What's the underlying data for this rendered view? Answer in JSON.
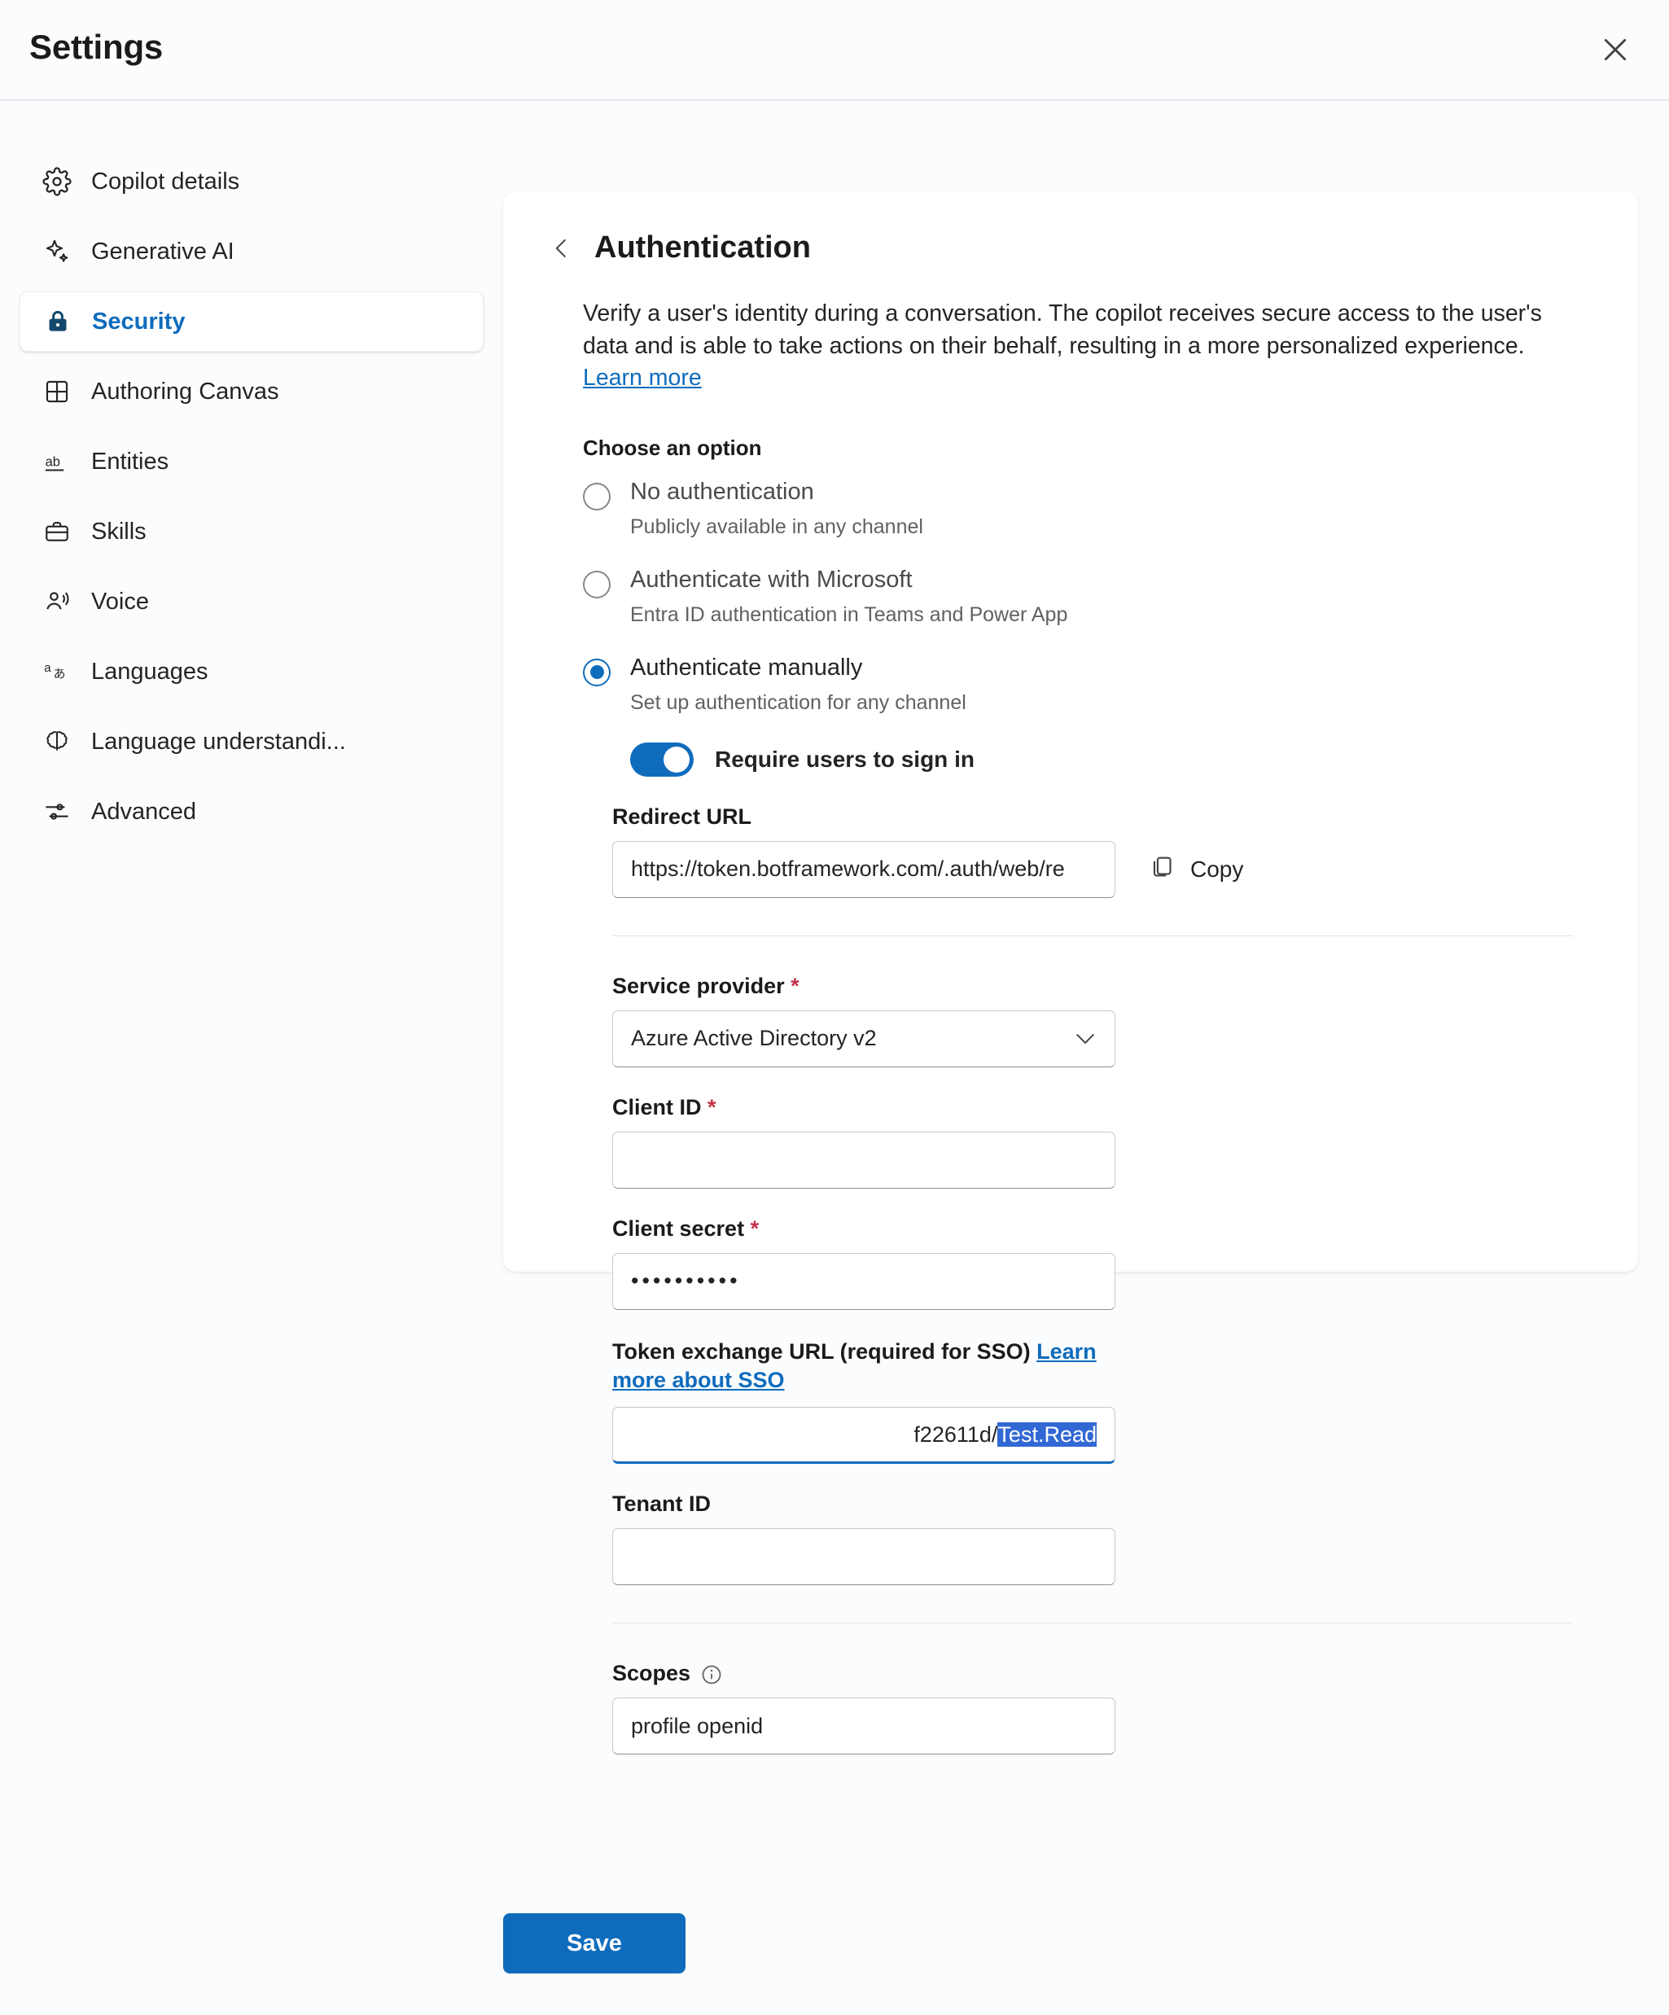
{
  "header": {
    "title": "Settings",
    "close_icon": "close-icon"
  },
  "sidebar": {
    "items": [
      {
        "label": "Copilot details",
        "icon": "gear-icon",
        "active": false
      },
      {
        "label": "Generative AI",
        "icon": "sparkle-icon",
        "active": false
      },
      {
        "label": "Security",
        "icon": "lock-icon",
        "active": true
      },
      {
        "label": "Authoring Canvas",
        "icon": "grid-icon",
        "active": false
      },
      {
        "label": "Entities",
        "icon": "ab-text-icon",
        "active": false
      },
      {
        "label": "Skills",
        "icon": "briefcase-icon",
        "active": false
      },
      {
        "label": "Voice",
        "icon": "person-speaking-icon",
        "active": false
      },
      {
        "label": "Languages",
        "icon": "translate-icon",
        "active": false
      },
      {
        "label": "Language understandi...",
        "icon": "brain-icon",
        "active": false
      },
      {
        "label": "Advanced",
        "icon": "sliders-icon",
        "active": false
      }
    ]
  },
  "panel": {
    "back_icon": "chevron-left-icon",
    "title": "Authentication",
    "description_part1": "Verify a user's identity during a conversation. The copilot receives secure access to the user's data and is able to take actions on their behalf, resulting in a more personalized experience. ",
    "description_link": "Learn more",
    "choose_label": "Choose an option",
    "options": [
      {
        "label": "No authentication",
        "sub": "Publicly available in any channel",
        "selected": false
      },
      {
        "label": "Authenticate with Microsoft",
        "sub": "Entra ID authentication in Teams and Power App",
        "selected": false
      },
      {
        "label": "Authenticate manually",
        "sub": "Set up authentication for any channel",
        "selected": true
      }
    ],
    "require_signin": {
      "label": "Require users to sign in",
      "on": true
    },
    "redirect_url": {
      "label": "Redirect URL",
      "value": "https://token.botframework.com/.auth/web/re",
      "copy_label": "Copy",
      "copy_icon": "copy-icon"
    },
    "service_provider": {
      "label": "Service provider",
      "required": "*",
      "value": "Azure Active Directory v2",
      "chevron_icon": "chevron-down-icon"
    },
    "client_id": {
      "label": "Client ID",
      "required": "*",
      "value": ""
    },
    "client_secret": {
      "label": "Client secret",
      "required": "*",
      "value": "••••••••••"
    },
    "token_exchange": {
      "label": "Token exchange URL (required for SSO) ",
      "link": "Learn more about SSO",
      "value_prefix": "f22611d/",
      "value_selected": "Test.Read",
      "selection_color": "#3268d4"
    },
    "tenant_id": {
      "label": "Tenant ID",
      "value": ""
    },
    "scopes": {
      "label": "Scopes",
      "info_icon": "info-icon",
      "value": "profile openid"
    }
  },
  "footer": {
    "save_label": "Save"
  },
  "colors": {
    "accent": "#0f6cbd",
    "required": "#c4314b",
    "selection": "#3268d4",
    "page_bg": "#fbfcfd"
  }
}
